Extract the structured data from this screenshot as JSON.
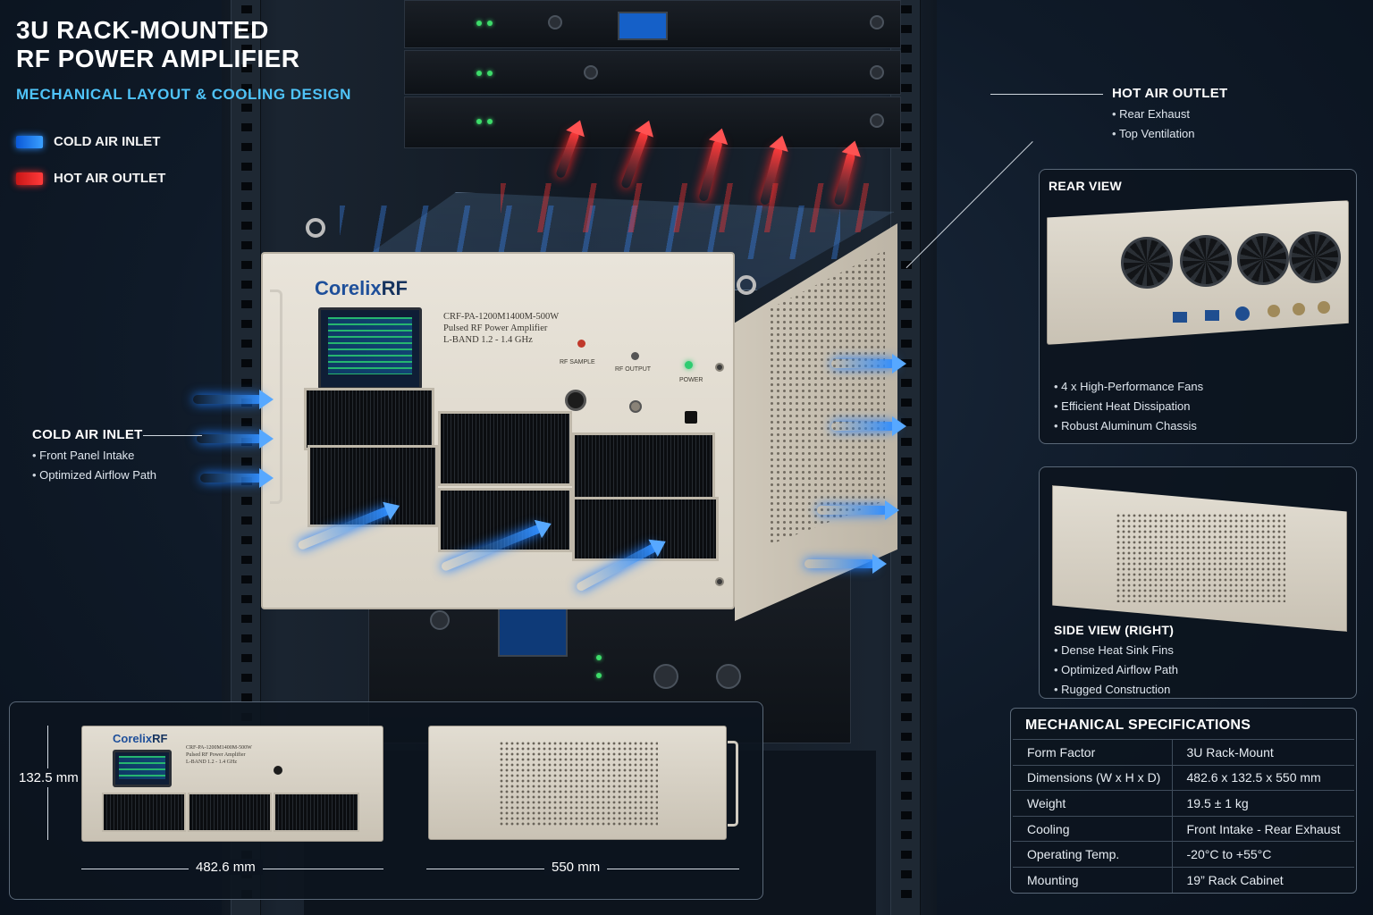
{
  "title": {
    "line1": "3U RACK-MOUNTED",
    "line2": "RF POWER AMPLIFIER"
  },
  "subtitle": "MECHANICAL LAYOUT & COOLING DESIGN",
  "legend": {
    "cold": "COLD AIR INLET",
    "hot": "HOT AIR OUTLET"
  },
  "colors": {
    "cold": "#2f8dff",
    "hot": "#ff3a3a",
    "accent": "#4fc3f7"
  },
  "amplifier": {
    "brand_a": "Corelix",
    "brand_b": "RF",
    "model_line1": "CRF-PA-1200M1400M-500W",
    "model_line2": "Pulsed RF Power Amplifier",
    "model_line3": "L-BAND 1.2 - 1.4 GHz",
    "rf_sample": "RF SAMPLE",
    "rf_output": "RF OUTPUT",
    "power": "POWER"
  },
  "hot_outlet": {
    "title": "HOT AIR OUTLET",
    "items": [
      "Rear Exhaust",
      "Top Ventilation"
    ]
  },
  "cold_inlet": {
    "title": "COLD AIR INLET",
    "items": [
      "Front Panel Intake",
      "Optimized Airflow Path"
    ]
  },
  "rear_view": {
    "title": "REAR VIEW",
    "items": [
      "4 x High-Performance Fans",
      "Efficient Heat Dissipation",
      "Robust Aluminum Chassis"
    ],
    "fan_icon": "fan-icon"
  },
  "side_view": {
    "title": "SIDE VIEW (RIGHT)",
    "items": [
      "Dense Heat Sink Fins",
      "Optimized Airflow Path",
      "Rugged Construction"
    ]
  },
  "dimensions": {
    "height": "132.5 mm",
    "width": "482.6 mm",
    "depth": "550 mm"
  },
  "specs": {
    "title": "MECHANICAL SPECIFICATIONS",
    "rows": [
      {
        "label": "Form Factor",
        "value": "3U Rack-Mount"
      },
      {
        "label": "Dimensions (W x H x D)",
        "value": "482.6 x 132.5 x 550 mm"
      },
      {
        "label": "Weight",
        "value": "19.5 ± 1 kg"
      },
      {
        "label": "Cooling",
        "value": "Front Intake - Rear Exhaust"
      },
      {
        "label": "Operating Temp.",
        "value": "-20°C to +55°C"
      },
      {
        "label": "Mounting",
        "value": "19” Rack Cabinet"
      }
    ]
  }
}
